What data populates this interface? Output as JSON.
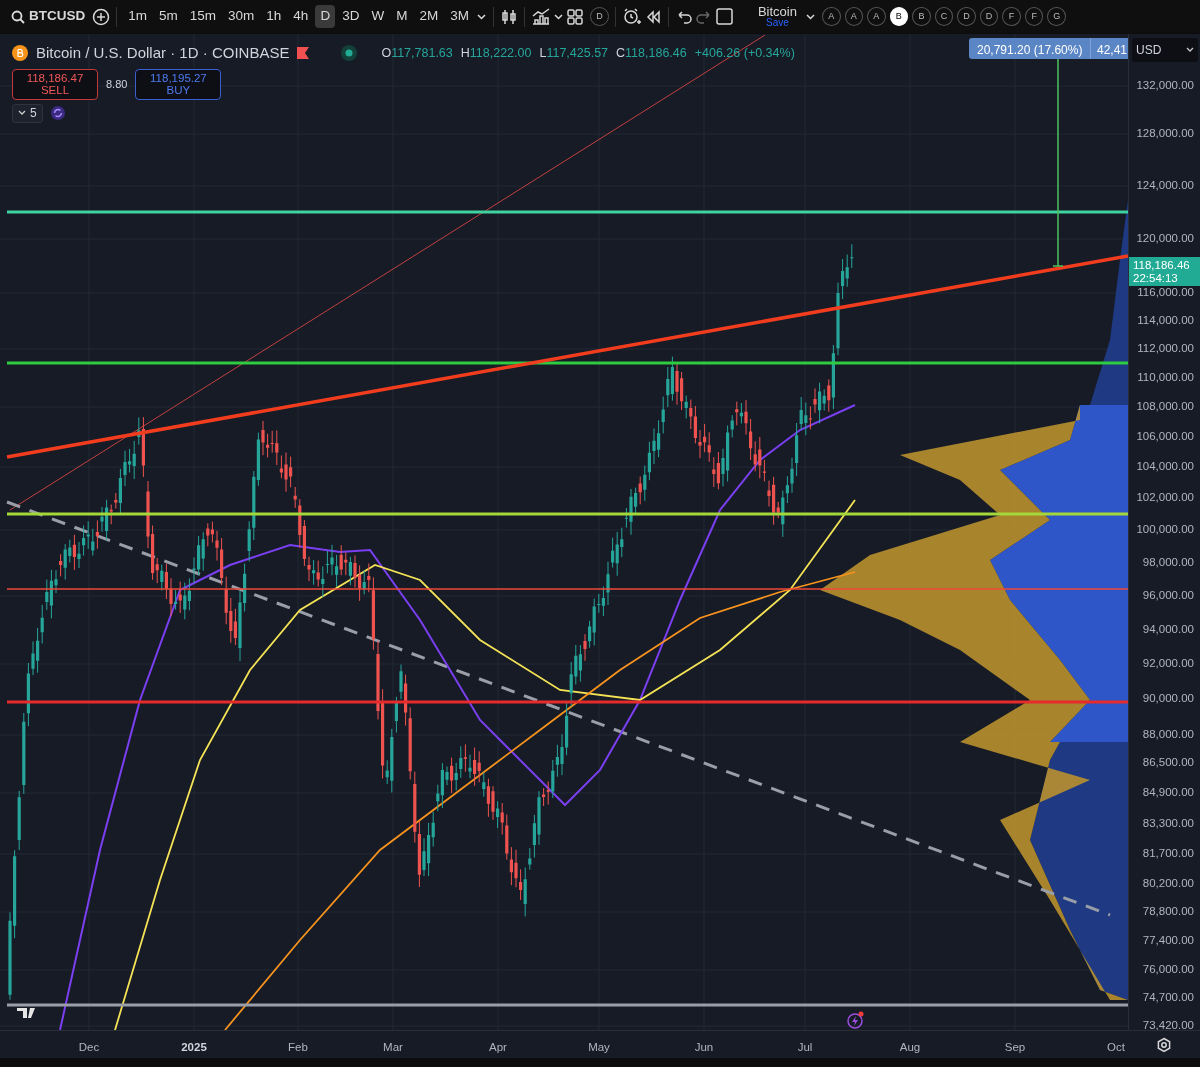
{
  "toolbar": {
    "symbol": "BTCUSD",
    "intervals": [
      {
        "label": "1m",
        "selected": false
      },
      {
        "label": "5m",
        "selected": false
      },
      {
        "label": "15m",
        "selected": false
      },
      {
        "label": "30m",
        "selected": false
      },
      {
        "label": "1h",
        "selected": false
      },
      {
        "label": "4h",
        "selected": false
      },
      {
        "label": "D",
        "selected": true
      },
      {
        "label": "3D",
        "selected": false
      },
      {
        "label": "W",
        "selected": false
      },
      {
        "label": "M",
        "selected": false
      },
      {
        "label": "2M",
        "selected": false
      },
      {
        "label": "3M",
        "selected": false
      }
    ],
    "layout_badge": "D",
    "layout": {
      "title": "Bitcoin",
      "action": "Save"
    },
    "letters": [
      {
        "label": "A",
        "selected": false
      },
      {
        "label": "A",
        "selected": false
      },
      {
        "label": "A",
        "selected": false
      },
      {
        "label": "B",
        "selected": true
      },
      {
        "label": "B",
        "selected": false
      },
      {
        "label": "C",
        "selected": false
      },
      {
        "label": "D",
        "selected": false
      },
      {
        "label": "D",
        "selected": false
      },
      {
        "label": "F",
        "selected": false
      },
      {
        "label": "F",
        "selected": false
      },
      {
        "label": "G",
        "selected": false
      }
    ]
  },
  "legend": {
    "title": "Bitcoin / U.S. Dollar · 1D · COINBASE",
    "ohlc": [
      {
        "label": "O",
        "value": "117,781.63"
      },
      {
        "label": "H",
        "value": "118,222.00"
      },
      {
        "label": "L",
        "value": "117,425.57"
      },
      {
        "label": "C",
        "value": "118,186.46"
      }
    ],
    "change": "+406.26 (+0.34%)"
  },
  "trade": {
    "sell": {
      "price": "118,186.47",
      "label": "SELL"
    },
    "spread": "8.80",
    "buy": {
      "price": "118,195.27",
      "label": "BUY"
    }
  },
  "indicators_count": "5",
  "measure": {
    "label": "20,791.20 (17.60%)",
    "extra": "42,41"
  },
  "price_axis": {
    "currency": "USD",
    "ticks": [
      "132,000.00",
      "128,000.00",
      "124,000.00",
      "120,000.00",
      "116,000.00",
      "114,000.00",
      "112,000.00",
      "110,000.00",
      "108,000.00",
      "106,000.00",
      "104,000.00",
      "102,000.00",
      "100,000.00",
      "98,000.00",
      "96,000.00",
      "94,000.00",
      "92,000.00",
      "90,000.00",
      "88,000.00",
      "86,500.00",
      "84,900.00",
      "83,300.00",
      "81,700.00",
      "80,200.00",
      "78,800.00",
      "77,400.00",
      "76,000.00",
      "74,700.00",
      "73,420.00"
    ],
    "last_price": {
      "price": "118,186.46",
      "countdown": "22:54:13"
    }
  },
  "time_axis": [
    {
      "label": "Dec",
      "kind": "month"
    },
    {
      "label": "2025",
      "kind": "year"
    },
    {
      "label": "Feb",
      "kind": "month"
    },
    {
      "label": "Mar",
      "kind": "month"
    },
    {
      "label": "Apr",
      "kind": "month"
    },
    {
      "label": "May",
      "kind": "month"
    },
    {
      "label": "Jun",
      "kind": "month"
    },
    {
      "label": "Jul",
      "kind": "month"
    },
    {
      "label": "Aug",
      "kind": "month"
    },
    {
      "label": "Sep",
      "kind": "month"
    },
    {
      "label": "Oct",
      "kind": "month"
    }
  ]
}
